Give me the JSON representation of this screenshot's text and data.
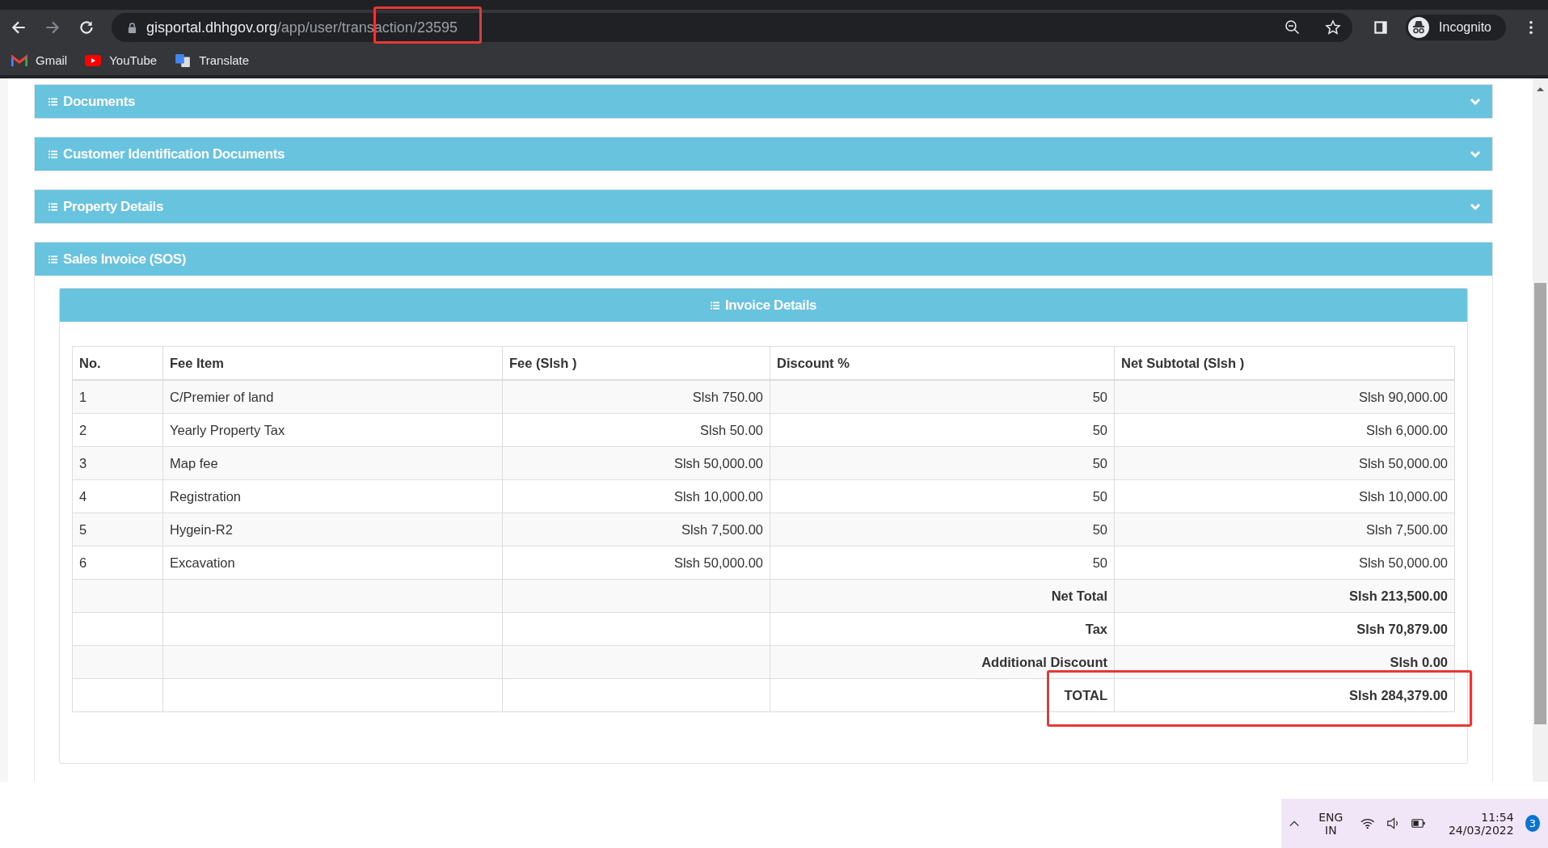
{
  "browser": {
    "url_host": "gisportal.dhhgov.org",
    "url_path": "/app/user/transaction/23595",
    "profile": "Incognito",
    "bookmarks": [
      {
        "label": "Gmail",
        "kind": "gmail"
      },
      {
        "label": "YouTube",
        "kind": "youtube"
      },
      {
        "label": "Translate",
        "kind": "translate"
      }
    ]
  },
  "sections": [
    {
      "title": "Documents",
      "expanded": false
    },
    {
      "title": "Customer Identification Documents",
      "expanded": false
    },
    {
      "title": "Property Details",
      "expanded": false
    },
    {
      "title": "Sales Invoice (SOS)",
      "expanded": true
    }
  ],
  "invoice": {
    "title": "Invoice Details",
    "columns": [
      "No.",
      "Fee Item",
      "Fee (Slsh )",
      "Discount %",
      "Net Subtotal (Slsh )"
    ],
    "rows": [
      {
        "no": "1",
        "fee_item": "C/Premier of land",
        "fee": "Slsh 750.00",
        "discount": "50",
        "net_subtotal": "Slsh 90,000.00"
      },
      {
        "no": "2",
        "fee_item": "Yearly Property Tax",
        "fee": "Slsh 50.00",
        "discount": "50",
        "net_subtotal": "Slsh 6,000.00"
      },
      {
        "no": "3",
        "fee_item": "Map fee",
        "fee": "Slsh 50,000.00",
        "discount": "50",
        "net_subtotal": "Slsh 50,000.00"
      },
      {
        "no": "4",
        "fee_item": "Registration",
        "fee": "Slsh 10,000.00",
        "discount": "50",
        "net_subtotal": "Slsh 10,000.00"
      },
      {
        "no": "5",
        "fee_item": "Hygein-R2",
        "fee": "Slsh 7,500.00",
        "discount": "50",
        "net_subtotal": "Slsh 7,500.00"
      },
      {
        "no": "6",
        "fee_item": "Excavation",
        "fee": "Slsh 50,000.00",
        "discount": "50",
        "net_subtotal": "Slsh 50,000.00"
      }
    ],
    "summary": [
      {
        "label": "Net Total",
        "value": "Slsh 213,500.00"
      },
      {
        "label": "Tax",
        "value": "Slsh 70,879.00"
      },
      {
        "label": "Additional Discount",
        "value": "Slsh 0.00"
      },
      {
        "label": "TOTAL",
        "value": "Slsh 284,379.00"
      }
    ]
  },
  "taskbar": {
    "language": "ENG",
    "region": "IN",
    "time": "11:54",
    "date": "24/03/2022",
    "notifications": "3"
  }
}
